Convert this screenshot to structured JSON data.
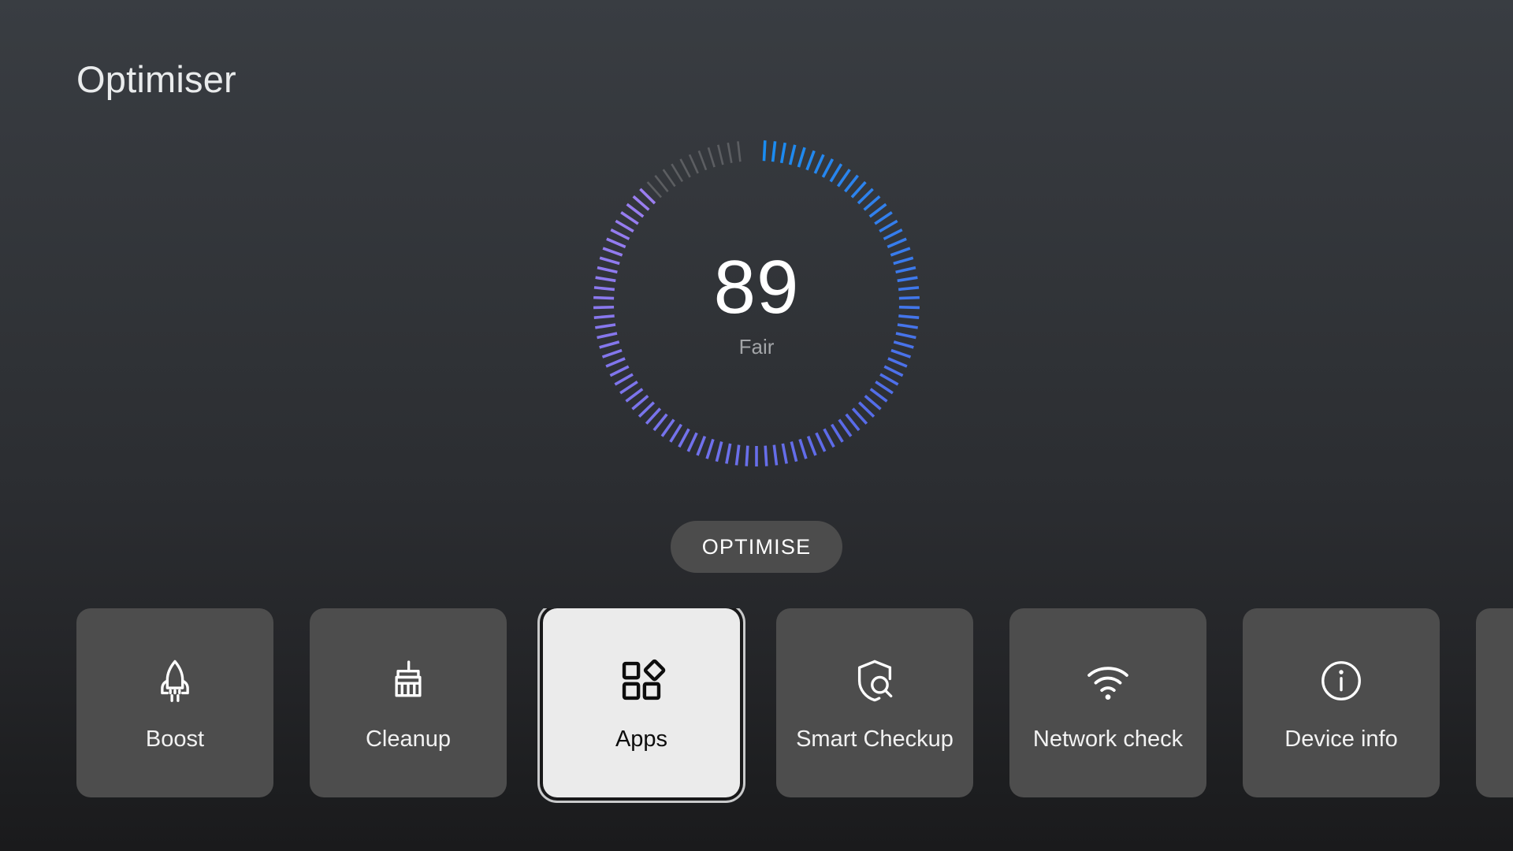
{
  "header": {
    "title": "Optimiser"
  },
  "gauge": {
    "score": "89",
    "status": "Fair",
    "score_number": 89,
    "max": 100,
    "total_ticks": 100,
    "filled_ticks": 89,
    "colors": {
      "start": "#1a8cf0",
      "mid": "#5a6ae8",
      "end": "#9b7ef0",
      "empty": "#6d6f72"
    }
  },
  "primary_action": {
    "label": "OPTIMISE"
  },
  "tiles": [
    {
      "label": "Boost",
      "icon": "rocket-icon",
      "selected": false
    },
    {
      "label": "Cleanup",
      "icon": "brush-icon",
      "selected": false
    },
    {
      "label": "Apps",
      "icon": "apps-grid-icon",
      "selected": true
    },
    {
      "label": "Smart Checkup",
      "icon": "shield-search-icon",
      "selected": false
    },
    {
      "label": "Network check",
      "icon": "wifi-icon",
      "selected": false
    },
    {
      "label": "Device info",
      "icon": "info-circle-icon",
      "selected": false
    },
    {
      "label": "",
      "icon": "",
      "selected": false
    }
  ]
}
